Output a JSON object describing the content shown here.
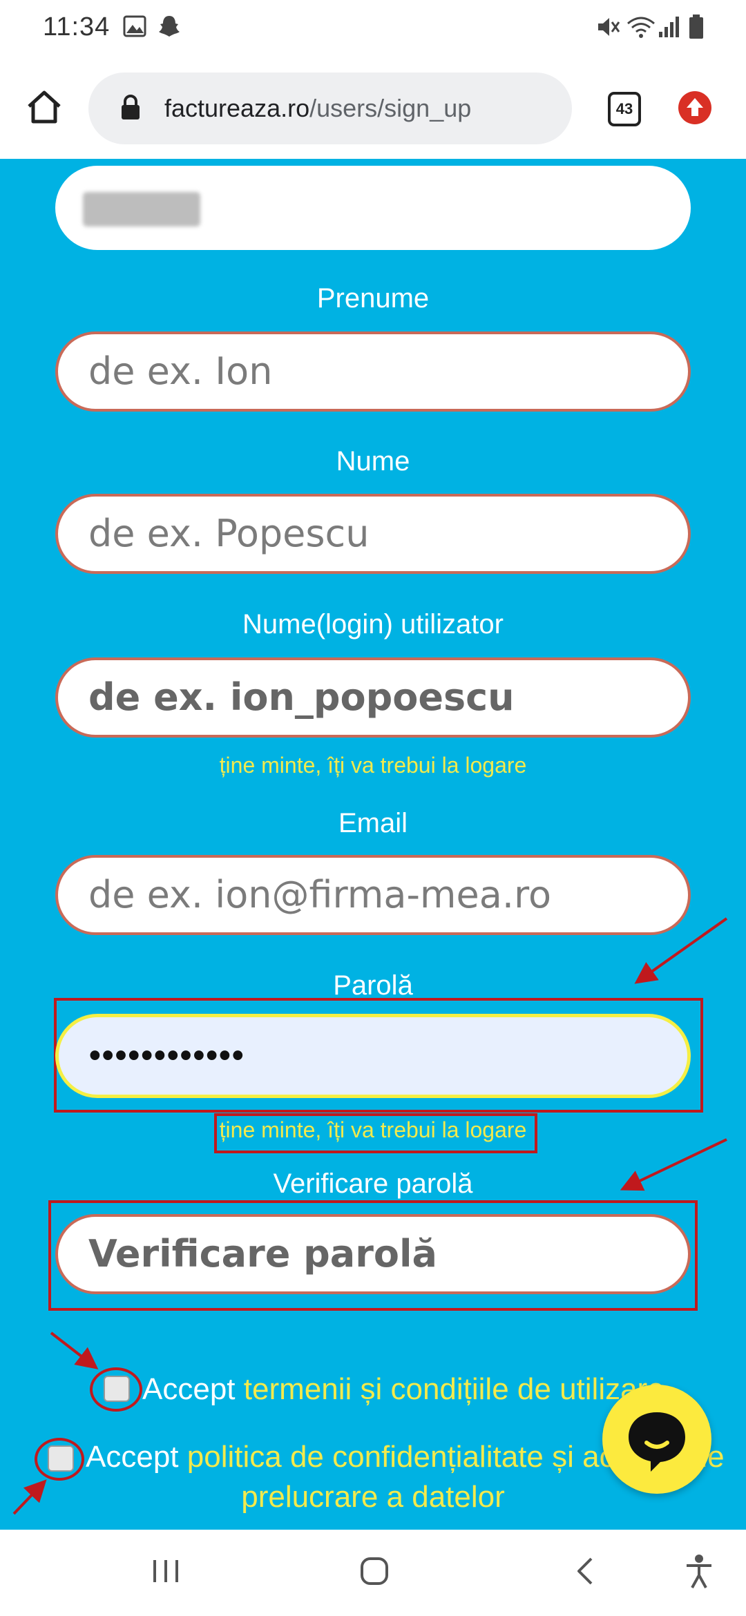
{
  "status_bar": {
    "time": "11:34"
  },
  "browser": {
    "url_host": "factureaza.ro",
    "url_path": "/users/sign_up",
    "tab_count": "43"
  },
  "form": {
    "first_name": {
      "label": "Prenume",
      "placeholder": "de ex. Ion"
    },
    "last_name": {
      "label": "Nume",
      "placeholder": "de ex. Popescu"
    },
    "username": {
      "label": "Nume(login) utilizator",
      "placeholder": "de ex. ion_popoescu",
      "hint": "ține minte, îți va trebui la logare"
    },
    "email": {
      "label": "Email",
      "placeholder": "de ex. ion@firma-mea.ro"
    },
    "password": {
      "label": "Parolă",
      "value_masked": "••••••••••••",
      "hint": "ține minte, îți va trebui la logare"
    },
    "password_confirm": {
      "label": "Verificare parolă",
      "placeholder": "Verificare parolă"
    },
    "terms": {
      "prefix": "Accept ",
      "link": "termenii și condițiile de utilizare"
    },
    "privacy": {
      "prefix": "Accept ",
      "link_line1": "politica de confidențialitate și acordul de",
      "link_line2": "prelucrare a datelor"
    }
  },
  "colors": {
    "background": "#00b2e3",
    "label": "#ffffff",
    "hint": "#f3ea4c",
    "annotation": "#c0191d",
    "chat_button": "#fcea3e"
  }
}
